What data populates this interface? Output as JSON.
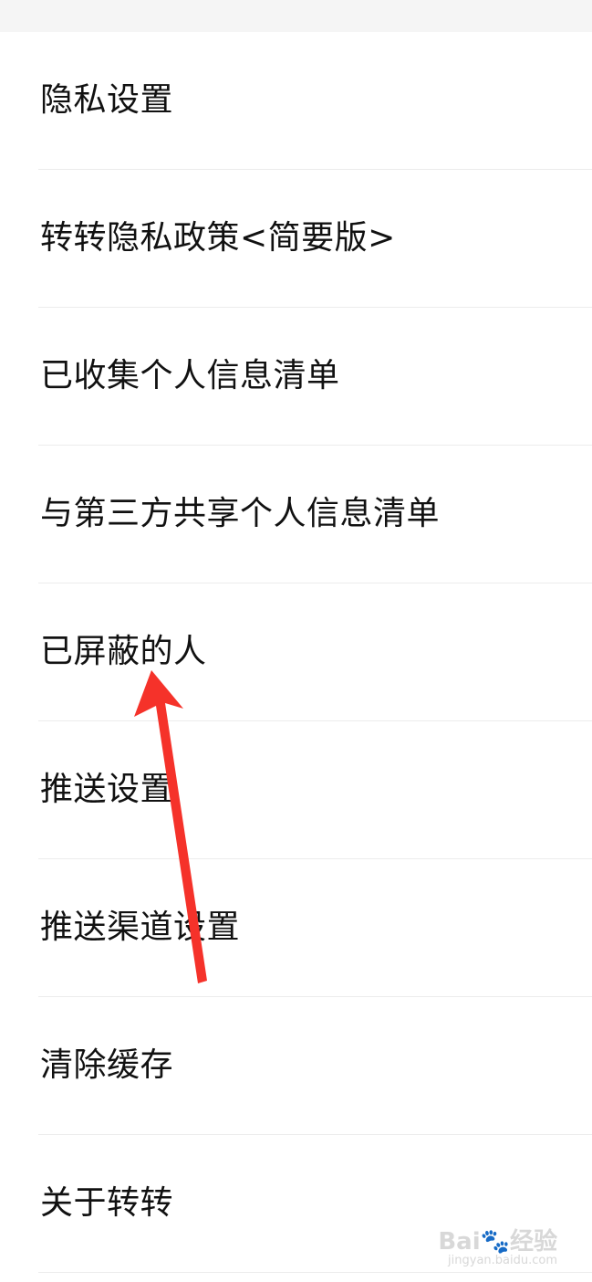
{
  "settings": {
    "items": [
      {
        "label": "隐私设置"
      },
      {
        "label": "转转隐私政策<简要版>"
      },
      {
        "label": "已收集个人信息清单"
      },
      {
        "label": "与第三方共享个人信息清单"
      },
      {
        "label": "已屏蔽的人"
      },
      {
        "label": "推送设置"
      },
      {
        "label": "推送渠道设置"
      },
      {
        "label": "清除缓存"
      },
      {
        "label": "关于转转"
      }
    ]
  },
  "annotation": {
    "arrow_color": "#f5322a",
    "points_to": "已屏蔽的人"
  },
  "watermark": {
    "brand": "Bai🐾经验",
    "url": "jingyan.baidu.com"
  }
}
